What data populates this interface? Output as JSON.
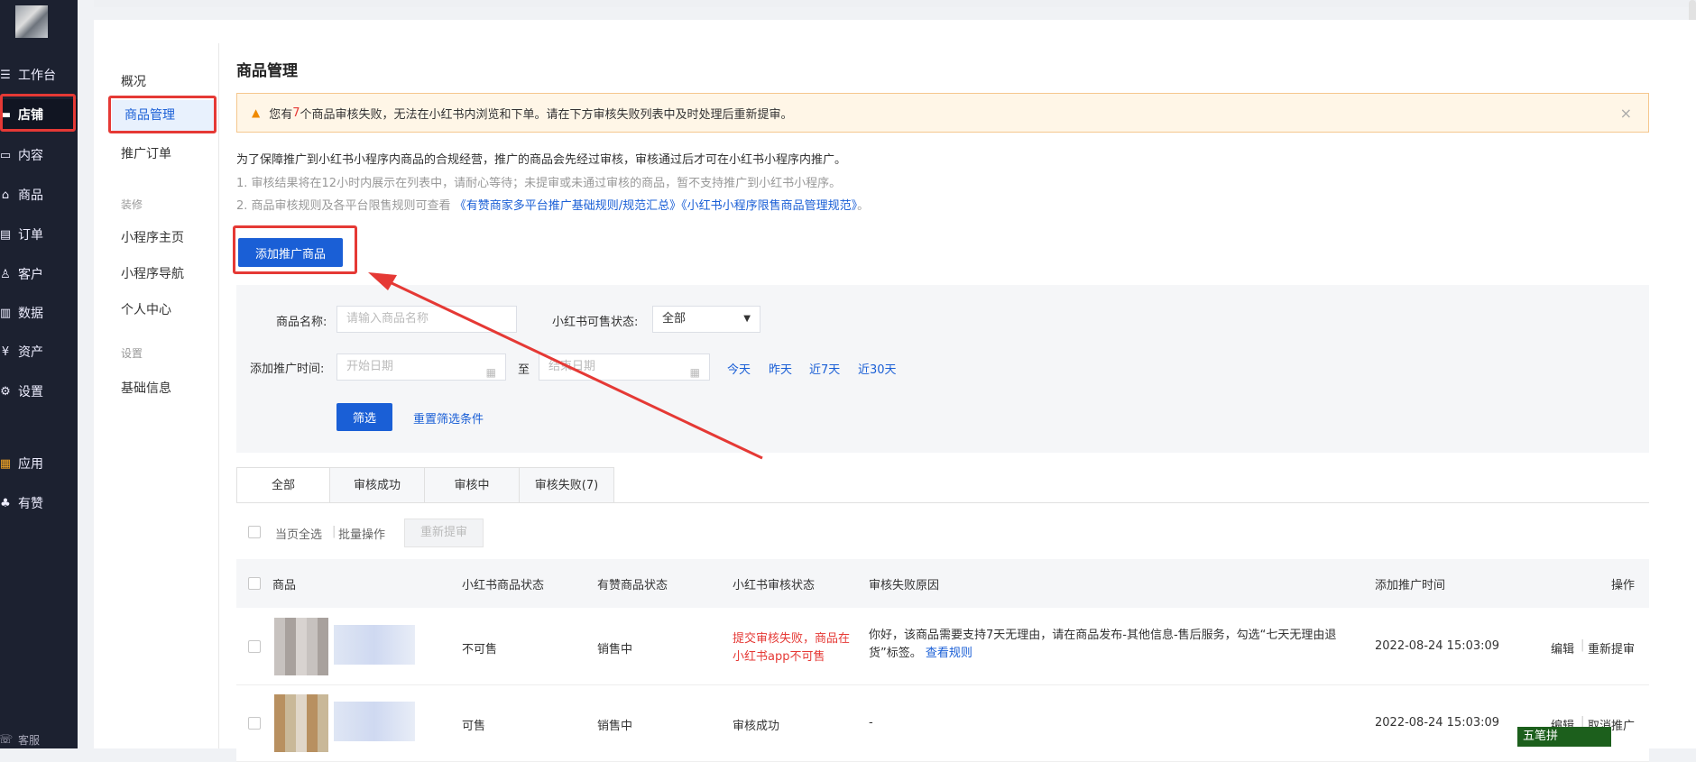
{
  "nav": {
    "items": [
      {
        "label": "工作台",
        "icon": "dashboard-icon",
        "glyph": "☰"
      },
      {
        "label": "店铺",
        "icon": "store-icon",
        "glyph": "▬"
      },
      {
        "label": "内容",
        "icon": "content-icon",
        "glyph": "▭"
      },
      {
        "label": "商品",
        "icon": "bag-icon",
        "glyph": "⌂"
      },
      {
        "label": "订单",
        "icon": "order-icon",
        "glyph": "▤"
      },
      {
        "label": "客户",
        "icon": "user-icon",
        "glyph": "♙"
      },
      {
        "label": "数据",
        "icon": "chart-icon",
        "glyph": "▥"
      },
      {
        "label": "资产",
        "icon": "yen-icon",
        "glyph": "¥"
      },
      {
        "label": "设置",
        "icon": "gear-icon",
        "glyph": "⚙"
      },
      {
        "label": "应用",
        "icon": "apps-icon",
        "glyph": "▦"
      },
      {
        "label": "有赞",
        "icon": "thumb-icon",
        "glyph": "♣"
      }
    ],
    "service_label": "客服"
  },
  "subnav": {
    "items": [
      "概况",
      "商品管理",
      "推广订单"
    ],
    "group_decor": "装修",
    "decor_items": [
      "小程序主页",
      "小程序导航",
      "个人中心"
    ],
    "group_settings": "设置",
    "settings_items": [
      "基础信息"
    ]
  },
  "page": {
    "title": "商品管理",
    "alert_pre": "您有",
    "alert_count": "7",
    "alert_post": "个商品审核失败，无法在小红书内浏览和下单。请在下方审核失败列表中及时处理后重新提审。",
    "desc_main": "为了保障推广到小红书小程序内商品的合规经营，推广的商品会先经过审核，审核通过后才可在小红书小程序内推广。",
    "desc_1": "1. 审核结果将在12小时内展示在列表中，请耐心等待；未提审或未通过审核的商品，暂不支持推广到小红书小程序。",
    "desc_2_pre": "2. 商品审核规则及各平台限售规则可查看",
    "desc_2_link": "《有赞商家多平台推广基础规则/规范汇总》《小红书小程序限售商品管理规范》",
    "desc_2_post": "。",
    "add_button": "添加推广商品"
  },
  "filter": {
    "name_label": "商品名称:",
    "name_placeholder": "请输入商品名称",
    "status_label": "小红书可售状态:",
    "status_value": "全部",
    "time_label": "添加推广时间:",
    "start_placeholder": "开始日期",
    "to": "至",
    "end_placeholder": "结束日期",
    "quick": [
      "今天",
      "昨天",
      "近7天",
      "近30天"
    ],
    "filter_button": "筛选",
    "reset_link": "重置筛选条件"
  },
  "tabs": [
    {
      "label": "全部"
    },
    {
      "label": "审核成功"
    },
    {
      "label": "审核中"
    },
    {
      "label": "审核失败(7)"
    }
  ],
  "batch": {
    "select_all": "当页全选",
    "batch_ops": "批量操作",
    "resubmit": "重新提审"
  },
  "table": {
    "headers": [
      "商品",
      "小红书商品状态",
      "有赞商品状态",
      "小红书审核状态",
      "审核失败原因",
      "添加推广时间",
      "操作"
    ],
    "rows": [
      {
        "xhs_status": "不可售",
        "yz_status": "销售中",
        "audit_status": "提交审核失败，商品在小红书app不可售",
        "reason": "你好，该商品需要支持7天无理由，请在商品发布-其他信息-售后服务，勾选“七天无理由退货”标签。",
        "reason_link": "查看规则",
        "time": "2022-08-24 15:03:09",
        "op1": "编辑",
        "op2": "重新提审"
      },
      {
        "xhs_status": "可售",
        "yz_status": "销售中",
        "audit_status": "审核成功",
        "reason": "-",
        "time": "2022-08-24 15:03:09",
        "op1": "编辑",
        "op2": "取消推广"
      }
    ]
  },
  "ime": "五笔拼",
  "colors": {
    "primary": "#1a5fd6",
    "annotation": "#e53935",
    "nav_bg": "#1c2130"
  }
}
